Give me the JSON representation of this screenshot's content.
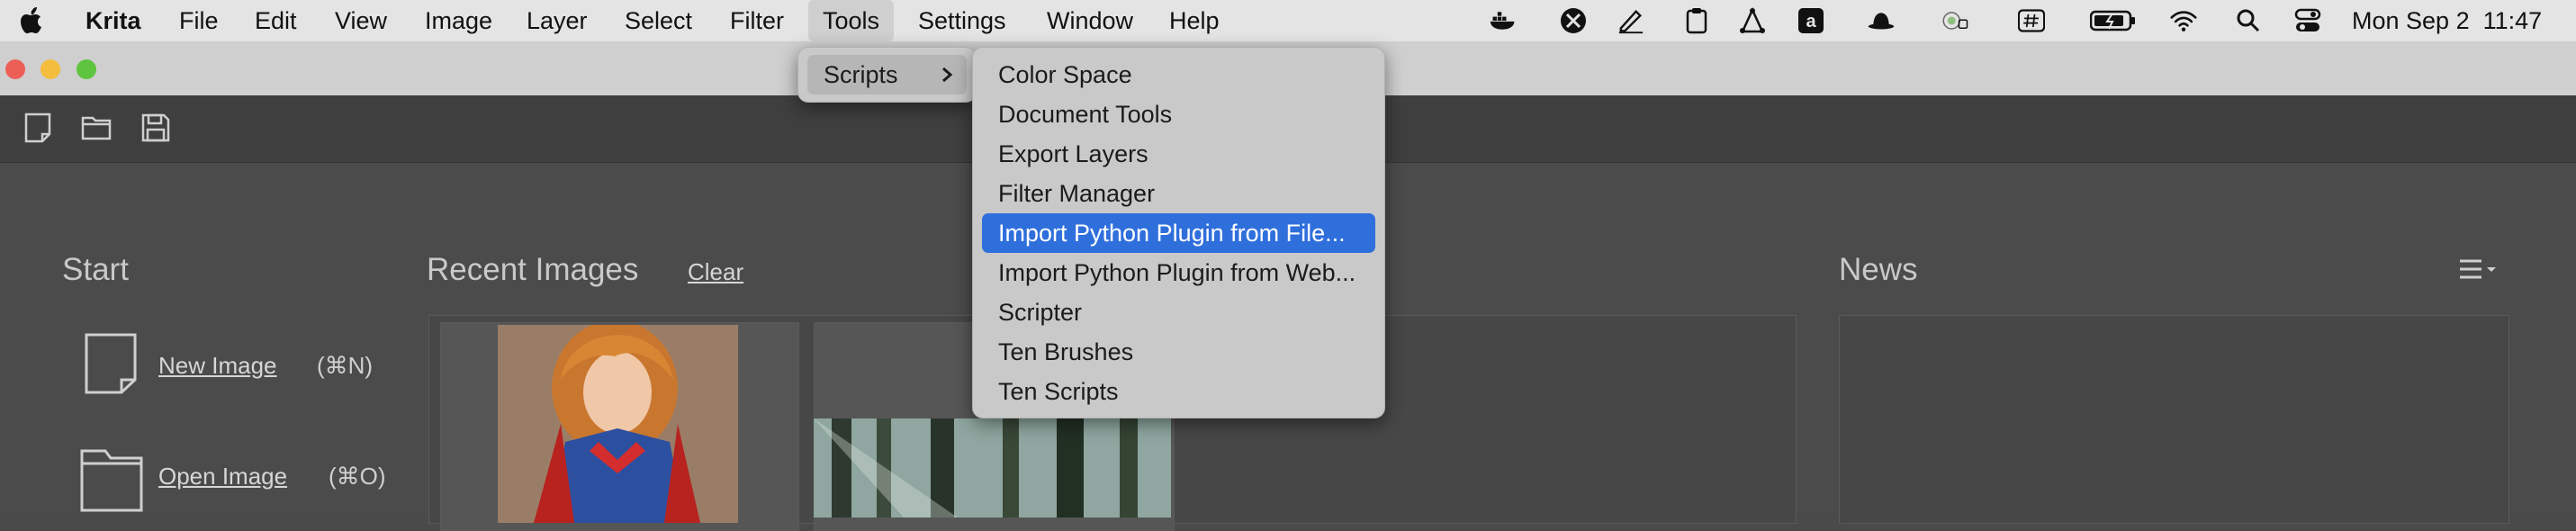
{
  "menubar": {
    "app_name": "Krita",
    "items": [
      "File",
      "Edit",
      "View",
      "Image",
      "Layer",
      "Select",
      "Filter",
      "Tools",
      "Settings",
      "Window",
      "Help"
    ],
    "active_item": "Tools",
    "clock": "Mon Sep 2  11:47",
    "status_icons": [
      "docker-icon",
      "krita-plus-icon",
      "pen-icon",
      "clipboard-icon",
      "vector-icon",
      "amazon-icon",
      "hat-icon",
      "vpn-icon",
      "hash-icon",
      "battery-icon",
      "wifi-icon",
      "search-icon",
      "control-center-icon"
    ]
  },
  "tools_menu": {
    "items": [
      {
        "label": "Scripts",
        "has_submenu": true
      }
    ]
  },
  "scripts_submenu": {
    "items": [
      "Color Space",
      "Document Tools",
      "Export Layers",
      "Filter Manager",
      "Import Python Plugin from File...",
      "Import Python Plugin from Web...",
      "Scripter",
      "Ten Brushes",
      "Ten Scripts"
    ],
    "highlighted": "Import Python Plugin from File..."
  },
  "toolbar": {
    "icons": [
      "new-document-icon",
      "open-folder-icon",
      "save-icon"
    ]
  },
  "start": {
    "heading": "Start",
    "new_image": "New Image",
    "new_image_shortcut": "(⌘N)",
    "open_image": "Open Image",
    "open_image_shortcut": "(⌘O)"
  },
  "recent": {
    "heading": "Recent Images",
    "clear": "Clear"
  },
  "news": {
    "heading": "News"
  }
}
